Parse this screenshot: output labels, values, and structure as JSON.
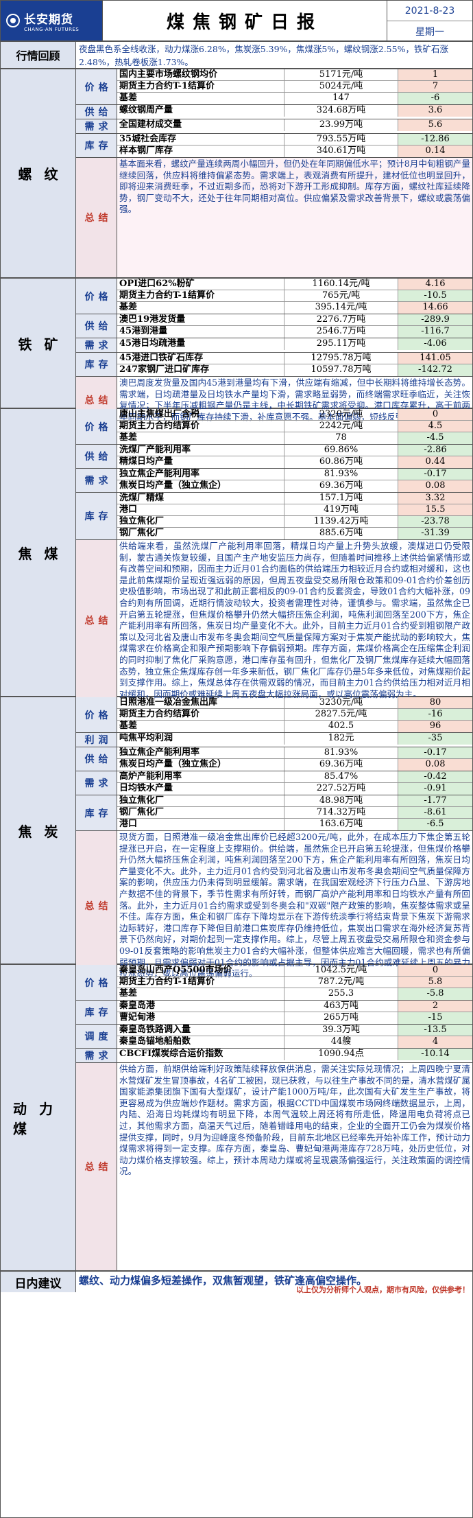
{
  "header": {
    "company_cn": "长安期货",
    "company_en": "CHANG·AN FUTURES",
    "title": "煤焦钢矿日报",
    "date": "2021-8-23",
    "weekday": "星期一"
  },
  "recap": {
    "label": "行情回顾",
    "text": "夜盘黑色系全线收涨，动力煤涨6.28%，焦炭涨5.39%，焦煤涨5%，螺纹钢涨2.55%，铁矿石涨2.48%，热轧卷板涨1.73%。"
  },
  "sections": [
    {
      "name": "螺纹",
      "height": 305,
      "groups": [
        {
          "label": "价格",
          "rows": [
            {
              "name": "国内主要市场螺纹钢均价",
              "value": "5171元/吨",
              "change": "1",
              "dir": "pos"
            },
            {
              "name": "期货主力合约T-1结算价",
              "value": "5024元/吨",
              "change": "7",
              "dir": "pos"
            },
            {
              "name": "基差",
              "value": "147",
              "change": "-6",
              "dir": "neg"
            }
          ]
        },
        {
          "label": "供给",
          "rows": [
            {
              "name": "螺纹钢周产量",
              "value": "324.68万吨",
              "change": "3.6",
              "dir": "pos"
            }
          ]
        },
        {
          "label": "需求",
          "rows": [
            {
              "name": "全国建材成交量",
              "value": "23.99万吨",
              "change": "5.6",
              "dir": "pos"
            }
          ]
        },
        {
          "label": "库存",
          "rows": [
            {
              "name": "35城社会库存",
              "value": "793.55万吨",
              "change": "-12.86",
              "dir": "neg"
            },
            {
              "name": "样本钢厂库存",
              "value": "340.61万吨",
              "change": "0.14",
              "dir": "pos"
            }
          ]
        }
      ],
      "summary_label": "总结",
      "summary": "基本面来看，螺纹产量连续两周小幅回升，但仍处在年同期偏低水平；预计8月中旬粗钢产量继续回落，供应料将维持偏紧态势。需求端上，表观消费有所提升，建材低位也明显回升，即将迎来消费旺季，不过近期多而，恐将对下游开工形成抑制。库存方面，螺纹社库延续降势，钢厂变动不大，还处于往年同期相对高位。供应偏紧及需求改善背景下，螺纹或震荡偏强。"
    },
    {
      "name": "铁矿",
      "height": 190,
      "groups": [
        {
          "label": "价格",
          "rows": [
            {
              "name": "OPI进口62%粉矿",
              "value": "1160.14元/吨",
              "change": "4.16",
              "dir": "pos"
            },
            {
              "name": "期货主力合约T-1结算价",
              "value": "765元/吨",
              "change": "-10.5",
              "dir": "neg"
            },
            {
              "name": "基差",
              "value": "395.14元/吨",
              "change": "14.66",
              "dir": "pos"
            }
          ]
        },
        {
          "label": "供给",
          "rows": [
            {
              "name": "澳巴19港发货量",
              "value": "2276.7万吨",
              "change": "-289.9",
              "dir": "neg"
            },
            {
              "name": "45港到港量",
              "value": "2546.7万吨",
              "change": "-116.7",
              "dir": "neg"
            }
          ]
        },
        {
          "label": "需求",
          "rows": [
            {
              "name": "45港日均疏港量",
              "value": "295.11万吨",
              "change": "-4.06",
              "dir": "neg"
            }
          ]
        },
        {
          "label": "库存",
          "rows": [
            {
              "name": "45港进口铁矿石库存",
              "value": "12795.78万吨",
              "change": "141.05",
              "dir": "pos"
            },
            {
              "name": "247家钢厂进口矿库存",
              "value": "10597.78万吨",
              "change": "-142.72",
              "dir": "neg"
            }
          ]
        }
      ],
      "summary_label": "总结",
      "summary": "澳巴周度发货量及国内45港到港量均有下滑，供应端有缩减，但中长期料将维持增长态势。需求端，日均疏港量及日均铁水产量均下滑，需求略显弱势，而终端需求旺季临近，关注恢复情况；下半年压减粗钢产量仍是主线，中长期铁矿需求将受抑。港口库存累升，高于前两年同期水平，而钢厂库存持续下滑，补库意愿不强。基本面偏弱，短线反弹空间或有限。"
    },
    {
      "name": "焦煤",
      "height": 420,
      "groups": [
        {
          "label": "价格",
          "rows": [
            {
              "name": "唐山主焦煤出厂含税",
              "value": "2320元/吨",
              "change": "0",
              "dir": "pos"
            },
            {
              "name": "期货主力合约结算价",
              "value": "2242元/吨",
              "change": "4.5",
              "dir": "pos"
            },
            {
              "name": "基差",
              "value": "78",
              "change": "-4.5",
              "dir": "neg"
            }
          ]
        },
        {
          "label": "供给",
          "rows": [
            {
              "name": "洗煤厂产能利用率",
              "value": "69.86%",
              "change": "-2.86",
              "dir": "neg"
            },
            {
              "name": "精煤日均产量",
              "value": "60.86万吨",
              "change": "0.44",
              "dir": "pos"
            }
          ]
        },
        {
          "label": "需求",
          "rows": [
            {
              "name": "独立焦企产能利用率",
              "value": "81.93%",
              "change": "-0.17",
              "dir": "neg"
            },
            {
              "name": "焦炭日均产量（独立焦企）",
              "value": "69.36万吨",
              "change": "0.08",
              "dir": "pos"
            }
          ]
        },
        {
          "label": "库存",
          "rows": [
            {
              "name": "洗煤厂精煤",
              "value": "157.1万吨",
              "change": "3.32",
              "dir": "pos"
            },
            {
              "name": "港口",
              "value": "419万吨",
              "change": "15.5",
              "dir": "pos"
            },
            {
              "name": "独立焦化厂",
              "value": "1139.42万吨",
              "change": "-23.78",
              "dir": "neg"
            },
            {
              "name": "钢厂焦化厂",
              "value": "885.6万吨",
              "change": "-31.39",
              "dir": "neg"
            }
          ]
        }
      ],
      "summary_label": "总结",
      "summary": "供给端来看，虽然洗煤厂产能利用率回落，精煤日均产量上升势头放缓，澳煤进口仍受限制，蒙古通关恢复较缓，且国产主产地安监压力尚存，但随着时间推移上述供给偏紧情形或有改善空间和预期，因而主力近月01合约面临的供给端压力相较近月合约或相对缓和，这也是此前焦煤期价呈现近强远弱的原因，但周五夜盘受交易所限仓政策和09-01合约价差创历史极值影响，市场出现了和此前正套相反的09-01合约反套资金，导致01合约大幅补涨，09合约则有所回调，近期行情波动较大，投资者需理性对待，谨慎参与。需求端，虽然焦企已开启第五轮提涨，但焦煤价格攀升仍然大幅挤压焦企利润，吨焦利润回落至200下方，焦企产能利用率有所回落，焦炭日均产量变化不大。此外，目前主力近月01合约受到粗钢限产政策以及河北省及唐山市发布冬奥会期间空气质量保障方案对于焦炭产能扰动的影响较大，焦煤需求在价格高企和限产预期影响下存偏弱预期。库存方面，焦煤价格高企在压缩焦企利润的同时抑制了焦化厂采购意愿，港口库存虽有回升，但焦化厂及钢厂焦煤库存延续大幅回落态势，独立焦企焦煤库存创一年多来新低，钢厂焦化厂库存仍是5年多来低位，对焦煤期价起到支撑作用。综上，焦煤总体存在供需双弱的情况，而目前主力01合约供给压力相对近月相对缓和，因而期价或难延续上周五夜盘大幅拉涨局面，或以高位震荡偏弱为主。"
    },
    {
      "name": "焦炭",
      "height": 390,
      "groups": [
        {
          "label": "价格",
          "rows": [
            {
              "name": "日照港准一级冶金焦出库",
              "value": "3230元/吨",
              "change": "80",
              "dir": "pos"
            },
            {
              "name": "期货主力合约结算价",
              "value": "2827.5元/吨",
              "change": "-16",
              "dir": "neg"
            },
            {
              "name": "基差",
              "value": "402.5",
              "change": "96",
              "dir": "pos"
            }
          ]
        },
        {
          "label": "利润",
          "rows": [
            {
              "name": "吨焦平均利润",
              "value": "182元",
              "change": "-35",
              "dir": "neg"
            }
          ]
        },
        {
          "label": "供给",
          "rows": [
            {
              "name": "独立焦企产能利用率",
              "value": "81.93%",
              "change": "-0.17",
              "dir": "neg"
            },
            {
              "name": "焦炭日均产量（独立焦企）",
              "value": "69.36万吨",
              "change": "0.08",
              "dir": "pos"
            }
          ]
        },
        {
          "label": "需求",
          "rows": [
            {
              "name": "高炉产能利用率",
              "value": "85.47%",
              "change": "-0.42",
              "dir": "neg"
            },
            {
              "name": "日均铁水产量",
              "value": "227.52万吨",
              "change": "-0.91",
              "dir": "neg"
            }
          ]
        },
        {
          "label": "库存",
          "rows": [
            {
              "name": "独立焦化厂",
              "value": "48.98万吨",
              "change": "-1.77",
              "dir": "neg"
            },
            {
              "name": "钢厂焦化厂",
              "value": "714.32万吨",
              "change": "-8.61",
              "dir": "neg"
            },
            {
              "name": "港口",
              "value": "163.6万吨",
              "change": "-6.5",
              "dir": "neg"
            }
          ]
        }
      ],
      "summary_label": "总结",
      "summary": "现货方面，日照港准一级冶金焦出库价已经超3200元/吨，此外，在成本压力下焦企第五轮提涨已开启，在一定程度上支撑期价。供给端，虽然焦企已开启第五轮提涨，但焦煤价格攀升仍然大幅挤压焦企利润，吨焦利润回落至200下方，焦企产能利用率有所回落，焦炭日均产量变化不大。此外，主力近月01合约受到河北省及唐山市发布冬奥会期间空气质量保障方案的影响，供应压力仍未得到明显缓解。需求端，在我国宏观经济下行压力凸显、下游房地产数据不佳的背景下，季节性需求有所好转，而钢厂高炉产能利用率和日均铁水产量有所回落。此外，主力近月01合约需求或受到冬奥会和\"双碳\"限产政策的影响，焦炭整体需求或呈不佳。库存方面，焦企和钢厂库存下降均显示在下游传统淡季行将结束背景下焦炭下游需求边际转好，港口库存下降但目前港口焦炭库存仍维持低位，焦炭出口需求在海外经济复苏背景下仍然向好，对期价起到一定支撑作用。综上，尽管上周五夜盘受交易所限仓和资金参与09-01反套策略的影响焦炭主力01合约大幅补涨，但整体供应难言大幅回暖，需求也有所偏弱预期，且需求偏弱对于01合约的影响或占据主导，因而主力01合约或难延续上周五的暴力拉涨态势，或以高位震荡偏弱运行。"
    },
    {
      "name": "动力煤",
      "height": 447,
      "groups": [
        {
          "label": "价格",
          "rows": [
            {
              "name": "秦皇岛山西产Q5500市场价",
              "value": "1042.5元/吨",
              "change": "0",
              "dir": "pos"
            },
            {
              "name": "期货主力合约T-1结算价",
              "value": "787.2元/吨",
              "change": "5.8",
              "dir": "pos"
            },
            {
              "name": "基差",
              "value": "255.3",
              "change": "-5.8",
              "dir": "neg"
            }
          ]
        },
        {
          "label": "库存",
          "rows": [
            {
              "name": "秦皇岛港",
              "value": "463万吨",
              "change": "2",
              "dir": "pos"
            },
            {
              "name": "曹妃甸港",
              "value": "265万吨",
              "change": "-15",
              "dir": "neg"
            }
          ]
        },
        {
          "label": "调度",
          "rows": [
            {
              "name": "秦皇岛铁路调入量",
              "value": "39.3万吨",
              "change": "-13.5",
              "dir": "neg"
            },
            {
              "name": "秦皇岛锚地船舶数",
              "value": "44艘",
              "change": "4",
              "dir": "pos"
            }
          ]
        },
        {
          "label": "需求",
          "rows": [
            {
              "name": "CBCFI煤炭综合运价指数",
              "value": "1090.94点",
              "change": "-10.14",
              "dir": "neg"
            }
          ]
        }
      ],
      "summary_label": "总结",
      "summary": "供给方面，前期供给端利好政策陆续释放保供消息，需关注实际兑现情况；上周四晚宁夏清水营煤矿发生冒顶事故，4名矿工被困，现已获救，与以往生产事故不同的是，清水营煤矿属国家能源集团旗下国有大型煤矿，设计产能1000万吨/年，此次国有大矿发生生产事故，将更容易成为供应端炒作题材。需求方面，根据CCTD中国煤炭市场网终端数据显示，上周，内陆、沿海日均耗煤均有明显下降，本周气温较上周还将有所走低，降温用电负荷将点已过，其他需求方面，高温天气过后，随着错峰用电的结束，企业的全面开工仍会为煤炭价格提供支撑，同时，9月为迎峰度冬预备阶段，目前东北地区已经率先开始补库工作，预计动力煤需求将得到一定支撑。库存方面，秦皇岛、曹妃甸港两港库存728万吨，处历史低位，对动力煤价格支撑较强。综上，预计本周动力煤或将呈现震荡偏强运行，关注政策面的调控情况。"
    }
  ],
  "footer": {
    "label": "日内建议",
    "advice": "螺纹、动力煤偏多短差操作，双焦暂观望，铁矿逢高偏空操作。",
    "disclaimer": "以上仅为分析师个人观点，期市有风险，仅供参考！"
  }
}
